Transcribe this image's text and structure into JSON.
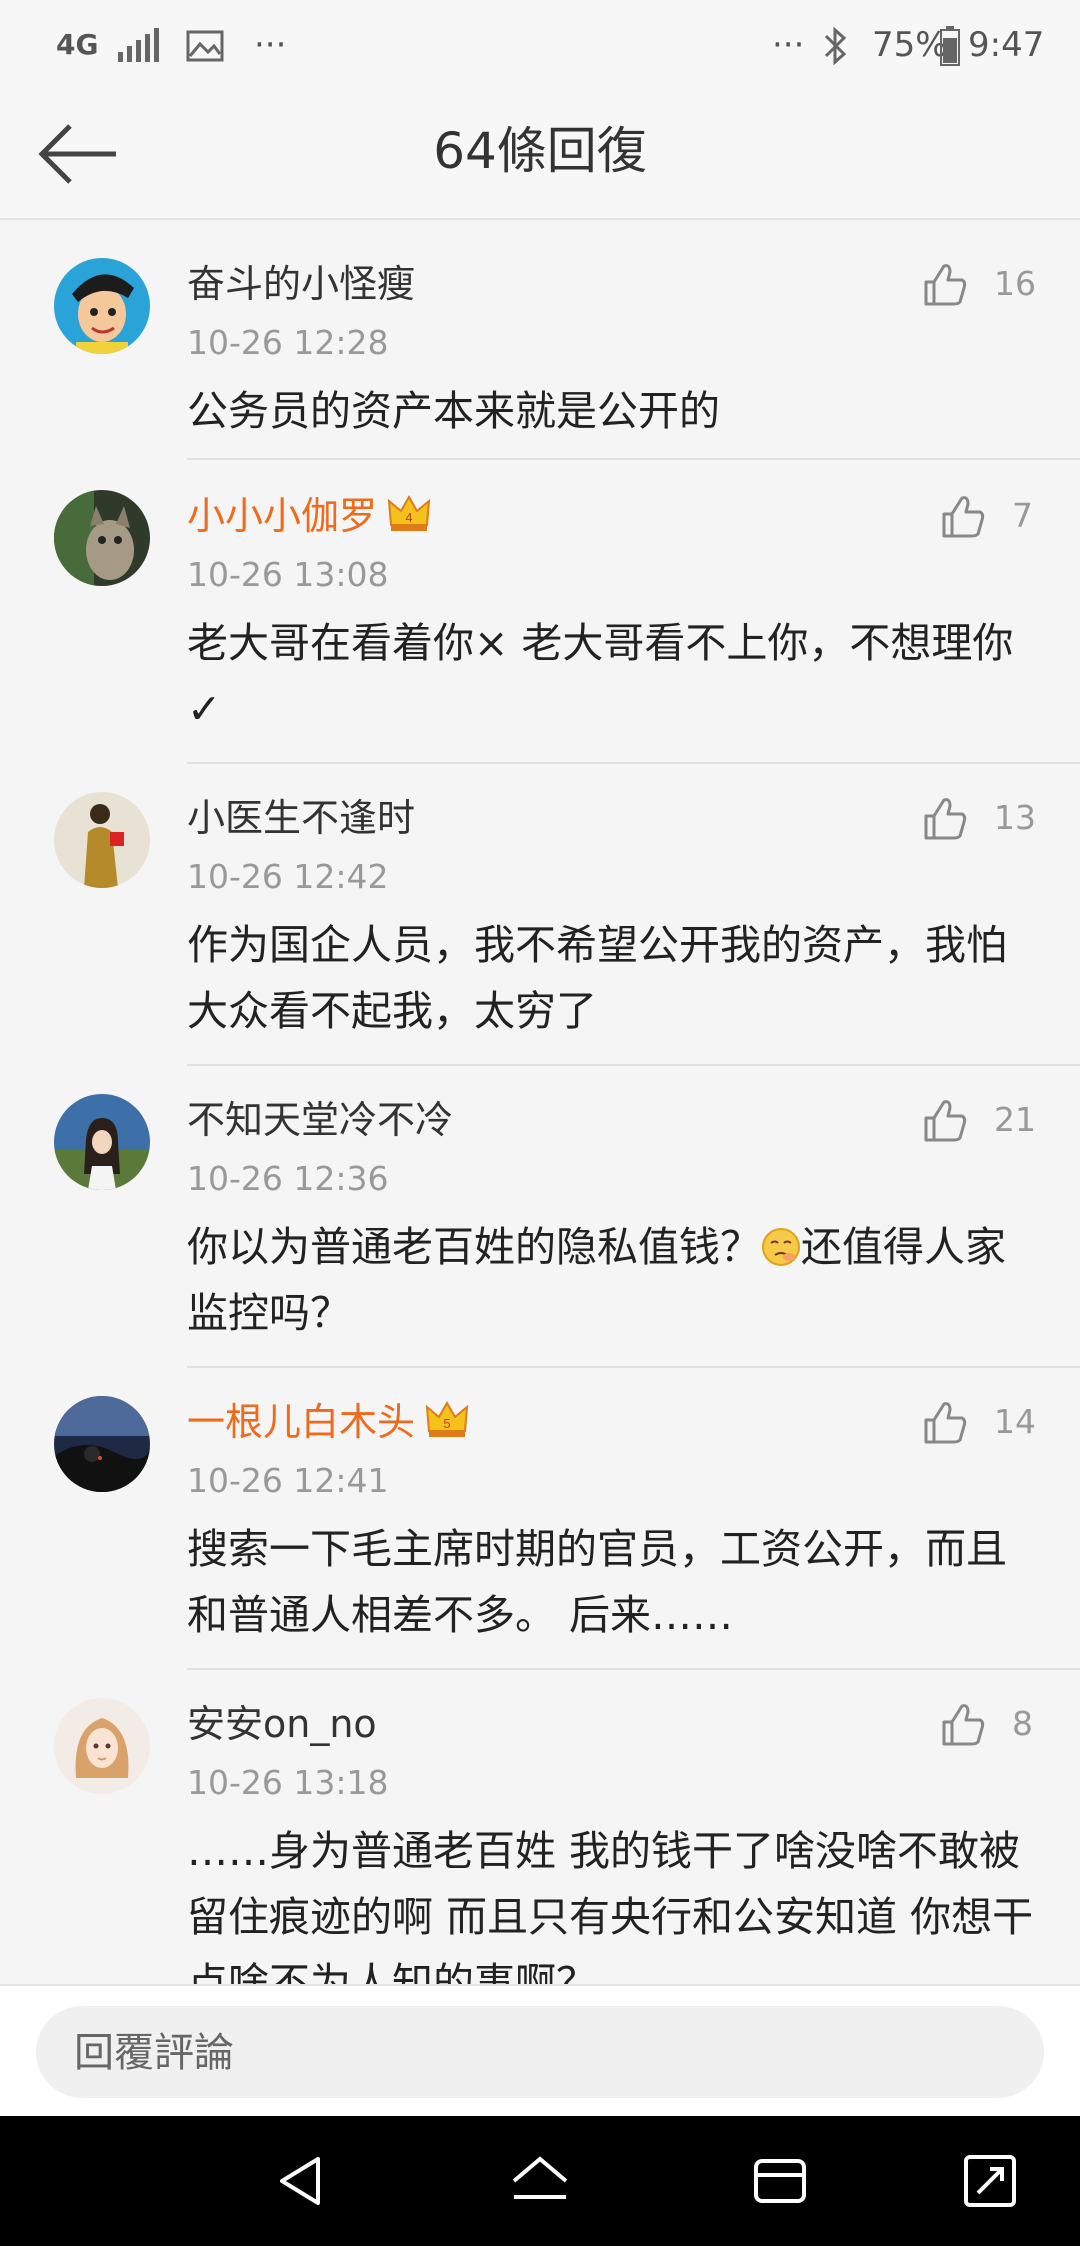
{
  "status_bar": {
    "network": "4G",
    "dots_left": "···",
    "dots_right": "···",
    "battery": "75%",
    "time": "9:47"
  },
  "header": {
    "title": "64條回復"
  },
  "comments": [
    {
      "user": "奋斗的小怪瘦",
      "vip": false,
      "time": "10-26 12:28",
      "likes": "16",
      "text": "公务员的资产本来就是公开的",
      "avatar_icon": "cartoon-avatar"
    },
    {
      "user": "小小小伽罗",
      "vip": true,
      "crown_level": "4",
      "time": "10-26 13:08",
      "likes": "7",
      "text": "老大哥在看着你× 老大哥看不上你，不想理你✓",
      "avatar_icon": "cat-avatar"
    },
    {
      "user": "小医生不逢时",
      "vip": false,
      "time": "10-26 12:42",
      "likes": "13",
      "text": "作为国企人员，我不希望公开我的资产，我怕大众看不起我，太穷了",
      "avatar_icon": "person-avatar"
    },
    {
      "user": "不知天堂冷不冷",
      "vip": false,
      "time": "10-26 12:36",
      "likes": "21",
      "text_before": "你以为普通老百姓的隐私值钱？",
      "text_after": "还值得人家监控吗？",
      "emoji": "smirk-emoji",
      "avatar_icon": "girl-avatar"
    },
    {
      "user": "一根儿白木头",
      "vip": true,
      "crown_level": "5",
      "time": "10-26 12:41",
      "likes": "14",
      "text": "搜索一下毛主席时期的官员，工资公开，而且和普通人相差不多。 后来……",
      "avatar_icon": "night-avatar"
    },
    {
      "user": "安安on_no",
      "vip": false,
      "time": "10-26 13:18",
      "likes": "8",
      "text": "……身为普通老百姓 我的钱干了啥没啥不敢被留住痕迹的啊 而且只有央行和公安知道 你想干点啥不为人知的事啊？",
      "avatar_icon": "anime-girl-avatar"
    }
  ],
  "reply_box": {
    "placeholder": "回覆評論"
  },
  "colors": {
    "vip_name": "#f06a1c",
    "text": "#222222",
    "meta": "#999999"
  }
}
